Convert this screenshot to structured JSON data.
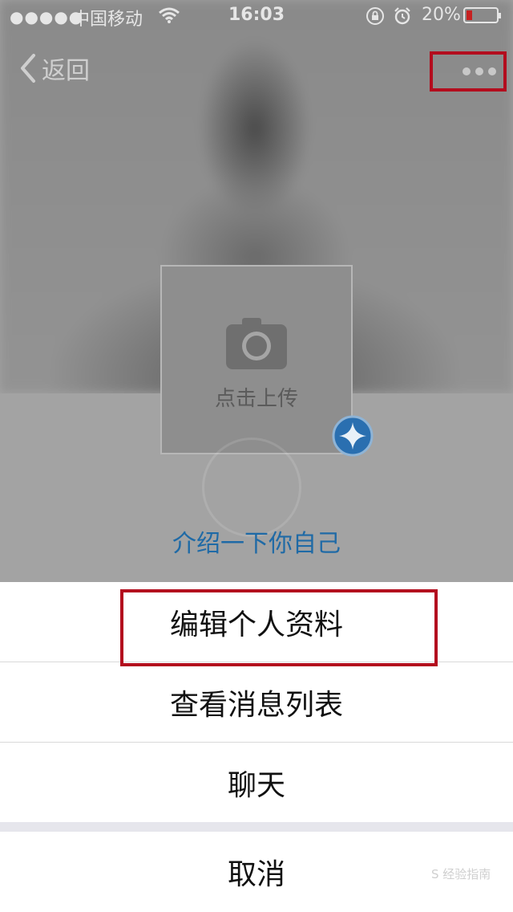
{
  "status_bar": {
    "signal": "●●●●●",
    "carrier": "中国移动",
    "time": "16:03",
    "battery": "20%",
    "battery_level_percent": 20,
    "icons": [
      "wifi-icon",
      "lock-rotation-icon",
      "alarm-icon",
      "battery-icon"
    ]
  },
  "nav": {
    "back_label": "返回",
    "back_icon": "chevron-left-icon",
    "more_icon": "more-dots-icon"
  },
  "profile": {
    "upload_label": "点击上传",
    "upload_icon": "camera-icon",
    "badge_icon": "star-badge-icon",
    "intro_link": "介绍一下你自己"
  },
  "action_sheet": {
    "items": [
      {
        "label": "编辑个人资料"
      },
      {
        "label": "查看消息列表"
      },
      {
        "label": "聊天"
      }
    ],
    "cancel_label": "取消"
  },
  "colors": {
    "highlight": "#b30d1e",
    "link": "#1f6aa6",
    "battery_low": "#c62020"
  },
  "watermark_text": "经验指南"
}
